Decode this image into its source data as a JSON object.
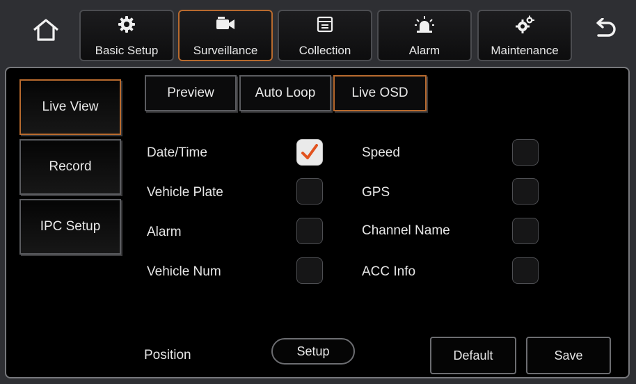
{
  "top_tabs": [
    {
      "label": "Basic Setup",
      "icon": "gear-icon"
    },
    {
      "label": "Surveillance",
      "icon": "video-camera-icon"
    },
    {
      "label": "Collection",
      "icon": "archive-box-icon"
    },
    {
      "label": "Alarm",
      "icon": "siren-icon"
    },
    {
      "label": "Maintenance",
      "icon": "gears-icon"
    }
  ],
  "active_top_tab": "Surveillance",
  "side_menu": [
    {
      "label": "Live View"
    },
    {
      "label": "Record"
    },
    {
      "label": "IPC Setup"
    }
  ],
  "active_side_item": "Live View",
  "sub_tabs": [
    {
      "label": "Preview"
    },
    {
      "label": "Auto Loop"
    },
    {
      "label": "Live OSD"
    }
  ],
  "active_sub_tab": "Live OSD",
  "osd_options": [
    {
      "label": "Date/Time",
      "checked": true
    },
    {
      "label": "Speed",
      "checked": false
    },
    {
      "label": "Vehicle Plate",
      "checked": false
    },
    {
      "label": "GPS",
      "checked": false
    },
    {
      "label": "Alarm",
      "checked": false
    },
    {
      "label": "Channel Name",
      "checked": false
    },
    {
      "label": "Vehicle Num",
      "checked": false
    },
    {
      "label": "ACC Info",
      "checked": false
    }
  ],
  "footer": {
    "position_label": "Position",
    "setup_label": "Setup",
    "default_label": "Default",
    "save_label": "Save"
  },
  "colors": {
    "accent": "#b86a2e",
    "checkmark": "#e2531f",
    "background": "#000000",
    "topbar": "#2e2f33"
  }
}
